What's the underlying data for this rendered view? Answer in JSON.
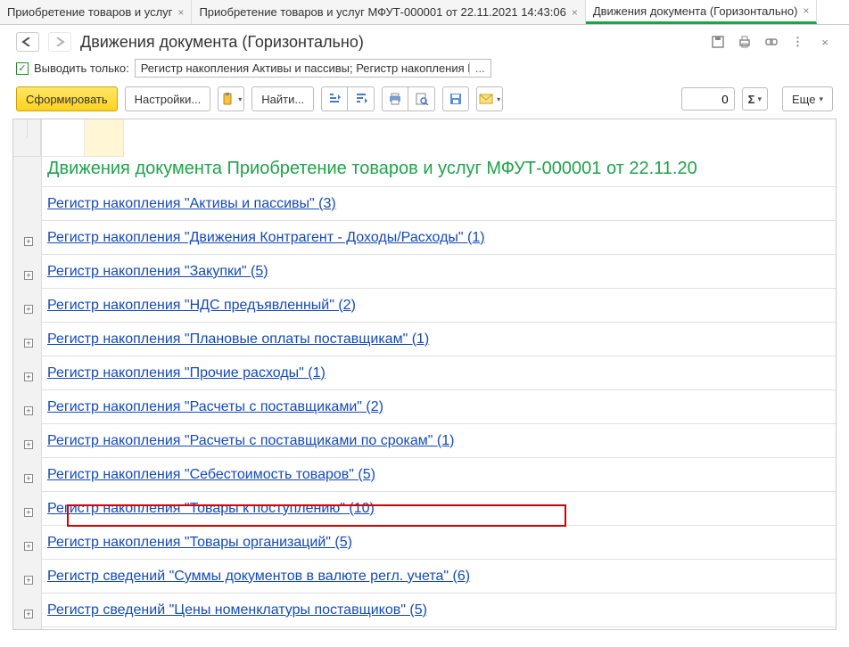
{
  "tabs": [
    {
      "label": "Приобретение товаров и услуг",
      "active": false
    },
    {
      "label": "Приобретение товаров и услуг МФУТ-000001 от 22.11.2021 14:43:06",
      "active": false
    },
    {
      "label": "Движения документа (Горизонтально)",
      "active": true
    }
  ],
  "header": {
    "title": "Движения документа (Горизонтально)"
  },
  "filter": {
    "checkbox_label": "Выводить только:",
    "value": "Регистр накопления Активы и пассивы; Регистр накопления Вы"
  },
  "toolbar": {
    "form_label": "Сформировать",
    "settings_label": "Настройки...",
    "find_label": "Найти...",
    "more_label": "Еще",
    "num_value": "0"
  },
  "report": {
    "title": "Движения документа Приобретение товаров и услуг МФУТ-000001 от 22.11.20",
    "rows": [
      "Регистр накопления \"Активы и пассивы\" (3)",
      "Регистр накопления \"Движения Контрагент - Доходы/Расходы\" (1)",
      "Регистр накопления \"Закупки\" (5)",
      "Регистр накопления \"НДС предъявленный\" (2)",
      "Регистр накопления \"Плановые оплаты поставщикам\" (1)",
      "Регистр накопления \"Прочие расходы\" (1)",
      "Регистр накопления \"Расчеты с поставщиками\" (2)",
      "Регистр накопления \"Расчеты с поставщиками по срокам\" (1)",
      "Регистр накопления \"Себестоимость товаров\" (5)",
      "Регистр накопления \"Товары к поступлению\" (10)",
      "Регистр накопления \"Товары организаций\" (5)",
      "Регистр сведений \"Суммы документов в валюте регл. учета\" (6)",
      "Регистр сведений \"Цены номенклатуры поставщиков\" (5)"
    ]
  }
}
